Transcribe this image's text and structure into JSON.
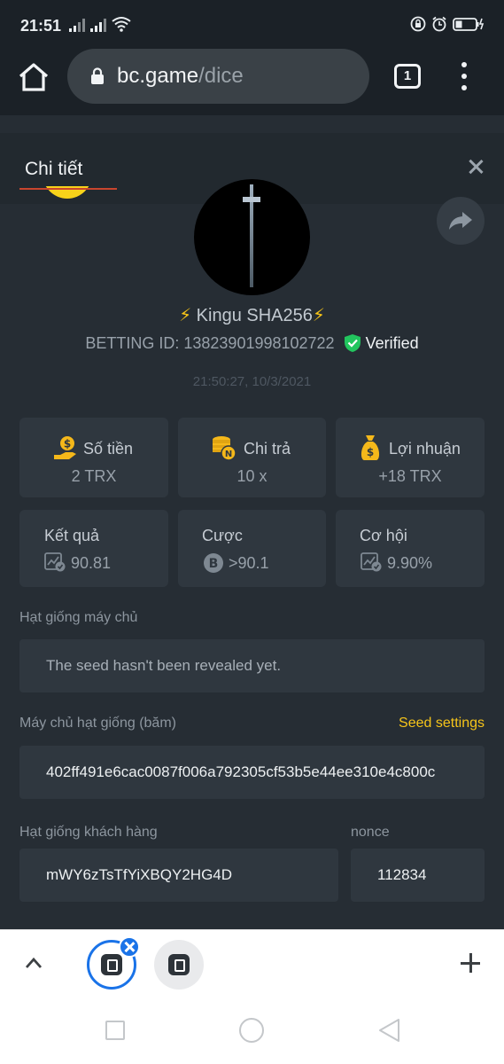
{
  "status_bar": {
    "time": "21:51"
  },
  "browser": {
    "url_host": "bc.game",
    "url_path": "/dice",
    "tab_count": "1"
  },
  "modal": {
    "title": "Chi tiết",
    "username_prefix": "⚡",
    "username": " Kingu SHA256",
    "username_suffix": "⚡",
    "betting_id": "BETTING ID: 13823901998102722",
    "verified_label": "Verified",
    "timestamp": "21:50:27, 10/3/2021",
    "stats_row1": [
      {
        "label": "Số tiền",
        "value": "2 TRX",
        "icon": "money-hand-icon"
      },
      {
        "label": "Chi trả",
        "value": "10 x",
        "icon": "coin-stack-icon"
      },
      {
        "label": "Lợi nhuận",
        "value": "+18 TRX",
        "icon": "money-bag-icon"
      }
    ],
    "stats_row2": [
      {
        "label": "Kết quả",
        "value": "90.81",
        "icon": "chart-check-icon"
      },
      {
        "label": "Cược",
        "value": ">90.1",
        "icon": "bitcoin-icon"
      },
      {
        "label": "Cơ hội",
        "value": "9.90%",
        "icon": "chart-check-icon"
      }
    ],
    "server_seed_label": "Hạt giống máy chủ",
    "server_seed_value": "The seed hasn't been revealed yet.",
    "hashed_seed_label": "Máy chủ hạt giống (băm)",
    "seed_settings": "Seed settings",
    "hashed_seed_value": "402ff491e6cac0087f006a792305cf53b5e44ee310e4c800c",
    "client_seed_label": "Hạt giống khách hàng",
    "client_seed_value": "mWY6zTsTfYiXBQY2HG4D",
    "nonce_label": "nonce",
    "nonce_value": "112834"
  },
  "colors": {
    "accent_yellow": "#f5c41a",
    "verified_green": "#22c55e",
    "tab_blue": "#1a73e8"
  }
}
